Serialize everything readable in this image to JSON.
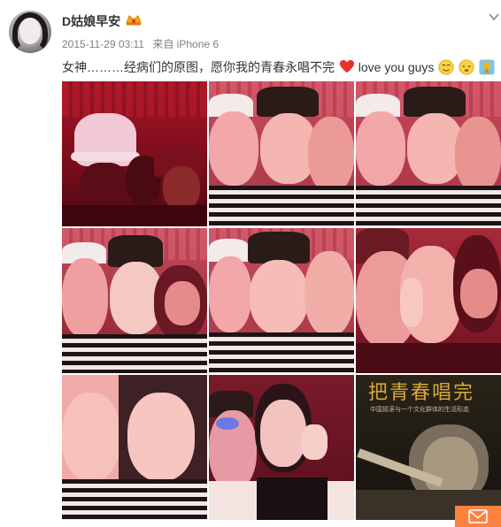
{
  "post": {
    "username": "D姑娘早安",
    "timestamp": "2015-11-29 03:11",
    "source_prefix": "来自",
    "source_device": "iPhone 6",
    "text": "女神………经病们的原图，愿你我的青春永唱不完",
    "text_en": "love you guys"
  },
  "icons": {
    "vip": "vip-badge-icon",
    "more": "chevron-down-icon",
    "heart": "heart-icon",
    "emoji_1": "sweat-smile-emoji-icon",
    "emoji_2": "sleepy-emoji-icon",
    "emoji_3": "trophy-icon",
    "message": "mail-icon"
  },
  "photos": [
    {
      "label": "photo-1"
    },
    {
      "label": "photo-2"
    },
    {
      "label": "photo-3"
    },
    {
      "label": "photo-4"
    },
    {
      "label": "photo-5"
    },
    {
      "label": "photo-6"
    },
    {
      "label": "photo-7"
    },
    {
      "label": "photo-8"
    },
    {
      "label": "photo-9"
    }
  ],
  "photo9_caption": "把青春唱完",
  "photo9_subcaption": "中国摇滚与一个文化群体的生活形态",
  "colors": {
    "accent": "#ff8140",
    "text": "#333333",
    "meta": "#808080"
  }
}
